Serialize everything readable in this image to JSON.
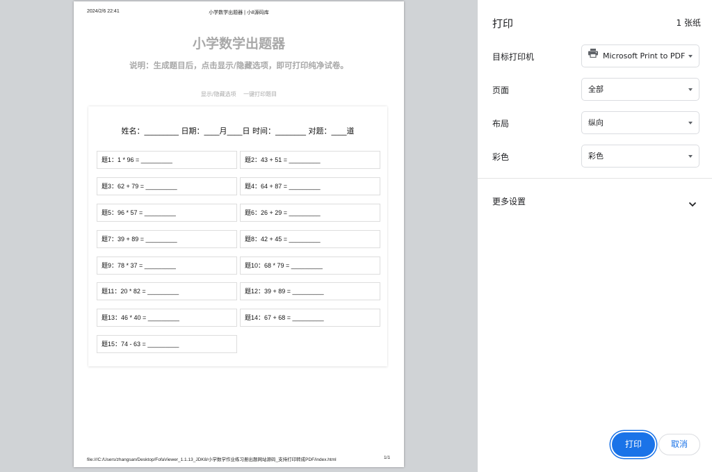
{
  "page": {
    "header_date": "2024/2/6 22:41",
    "header_title": "小学数学出题器 | 小8源码库",
    "title": "小学数学出题器",
    "description": "说明：生成题目后，点击显示/隐藏选项，即可打印纯净试卷。",
    "controls": {
      "toggle_label": "显示/隐藏选项",
      "print_label": "一键打印题目"
    },
    "info_line": "姓名：_________ 日期：____月____日 时间：________ 对题：____道",
    "questions": [
      "题1：1 * 96 = _________",
      "题2：43 + 51 = _________",
      "题3：62 + 79 = _________",
      "题4：64 + 87 = _________",
      "题5：96 * 57 = _________",
      "题6：26 + 29 = _________",
      "题7：39 + 89 = _________",
      "题8：42 + 45 = _________",
      "题9：78 * 37 = _________",
      "题10：68 * 79 = _________",
      "题11：20 * 82 = _________",
      "题12：39 + 89 = _________",
      "题13：46 * 40 = _________",
      "题14：67 + 68 = _________",
      "题15：74 - 63 = _________"
    ],
    "footer_path": "file:///C:/Users/zhangsan/Desktop/FofaViewer_1.1.13_JDK8/小学数学作业练习册出题网站源码_支持打印转成PDF/index.html",
    "footer_page": "1/1"
  },
  "panel": {
    "title": "打印",
    "sheet_count": "1 张纸",
    "destination": {
      "label": "目标打印机",
      "value": "Microsoft Print to PDF",
      "icon": "printer-icon"
    },
    "pages": {
      "label": "页面",
      "value": "全部"
    },
    "layout": {
      "label": "布局",
      "value": "纵向"
    },
    "color": {
      "label": "彩色",
      "value": "彩色"
    },
    "more_settings": "更多设置",
    "print_button": "打印",
    "cancel_button": "取消",
    "accent_color": "#1a73e8"
  }
}
